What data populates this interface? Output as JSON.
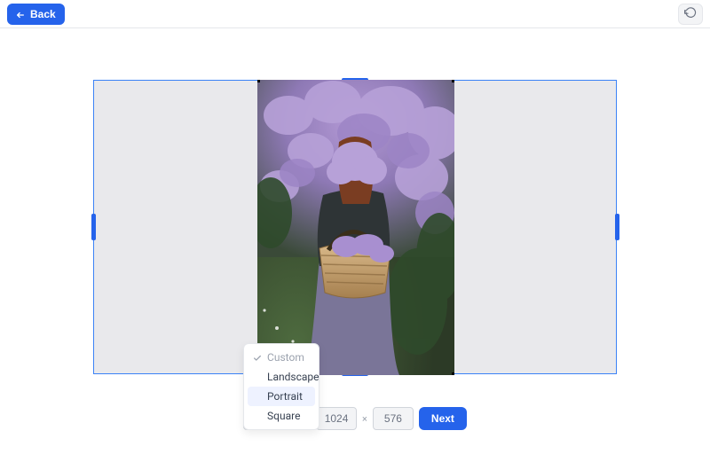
{
  "header": {
    "back_label": "Back"
  },
  "canvas": {
    "width_value": "1024",
    "height_value": "576",
    "next_label": "Next"
  },
  "aspect": {
    "trigger_label": "Portrait",
    "items": {
      "custom": {
        "label": "Custom",
        "checked": true,
        "disabled": true,
        "highlight": false
      },
      "landscape": {
        "label": "Landscape",
        "checked": false,
        "disabled": false,
        "highlight": false
      },
      "portrait": {
        "label": "Portrait",
        "checked": false,
        "disabled": false,
        "highlight": true
      },
      "square": {
        "label": "Square",
        "checked": false,
        "disabled": false,
        "highlight": false
      }
    }
  }
}
